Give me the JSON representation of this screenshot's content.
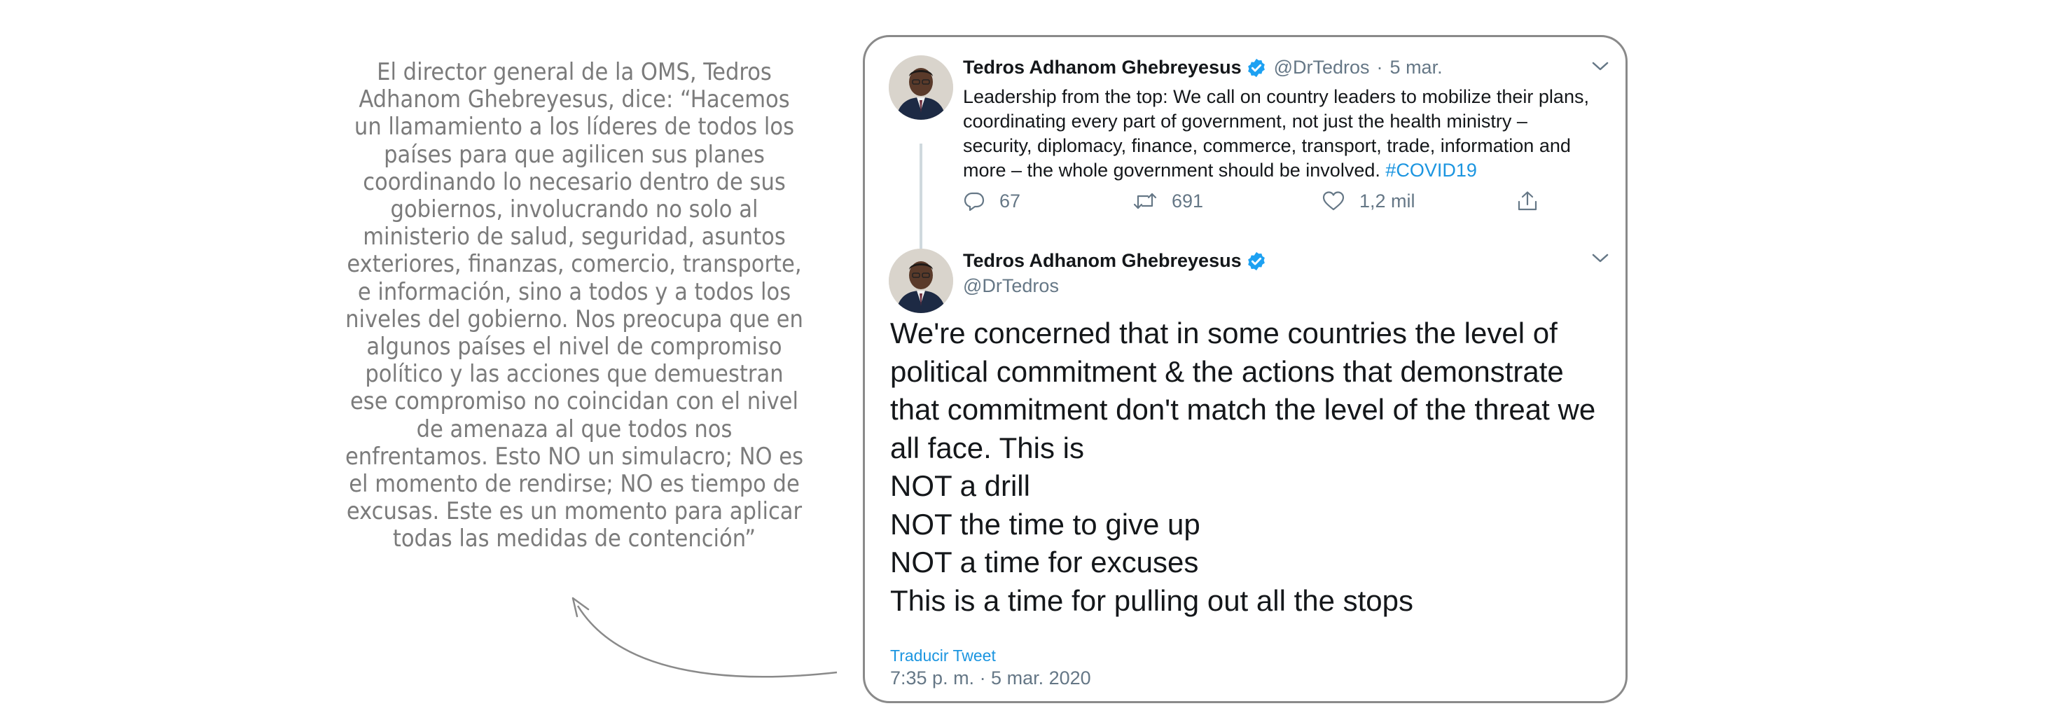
{
  "quote": {
    "text": "El director general de la OMS, Tedros Adhanom Ghebreyesus, dice: “Hacemos un llamamiento a los líderes de todos los países para que agilicen sus planes coordinando lo necesario dentro de sus gobiernos, involucrando no solo al ministerio de salud, seguridad, asuntos exteriores, finanzas, comercio, transporte, e información, sino a todos y a todos los niveles del gobierno. Nos preocupa que en algunos países el nivel de compromiso político y las acciones que demuestran ese compromiso no coincidan con el nivel de amenaza al que todos nos enfrentamos. Esto NO un simulacro; NO es el momento de rendirse; NO es tiempo de excusas. Este es un momento para aplicar todas las medidas de contención”"
  },
  "tweet1": {
    "author_name": "Tedros Adhanom Ghebreyesus",
    "handle": "@DrTedros",
    "separator": "·",
    "date": "5 mar.",
    "text": "Leadership from the top: We call on country leaders to mobilize their plans, coordinating every part of government, not just the health ministry – security, diplomacy, finance, commerce, transport, trade, information and more – the whole government should be involved. ",
    "hashtag": "#COVID19",
    "replies": "67",
    "retweets": "691",
    "likes": "1,2 mil"
  },
  "tweet2": {
    "author_name": "Tedros Adhanom Ghebreyesus",
    "handle": "@DrTedros",
    "text": "We're concerned that in some countries the level of political commitment & the actions that demonstrate that commitment don't match the level of the threat we all face. This is\nNOT a drill\nNOT the time to give up\nNOT a time for excuses\nThis is a time for pulling out all the stops",
    "translate_label": "Traducir Tweet",
    "timestamp": "7:35 p. m. · 5 mar. 2020"
  },
  "colors": {
    "link": "#1b95e0",
    "verified": "#1da1f2",
    "muted": "#657786",
    "quote_text": "#7b7b7b",
    "card_border": "#8a8a8a"
  },
  "icons": [
    "verified-badge-icon",
    "chevron-down-icon",
    "reply-icon",
    "retweet-icon",
    "like-icon",
    "share-icon",
    "curved-arrow-icon"
  ]
}
